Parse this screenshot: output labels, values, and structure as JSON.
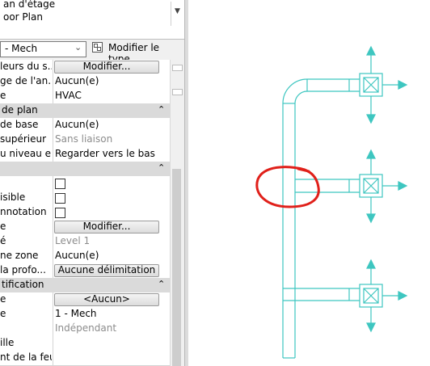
{
  "header": {
    "line1": "an d'étage",
    "line2": "oor Plan"
  },
  "type_selector": {
    "value": "- Mech"
  },
  "edit_type_label": "Modifier le type",
  "rows": [
    {
      "key": "leurs du s...",
      "button": "Modifier..."
    },
    {
      "key": "ge de l'an...",
      "value": "Aucun(e)"
    },
    {
      "key": "e",
      "value": "HVAC"
    },
    {
      "section": " de plan",
      "chevron": "⌃"
    },
    {
      "key": " de base",
      "value": "Aucun(e)"
    },
    {
      "key": "supérieur",
      "value": "Sans liaison",
      "muted": true
    },
    {
      "key": "u niveau e...",
      "value": "Regarder vers le bas"
    },
    {
      "section": "",
      "chevron": "⌃"
    },
    {
      "key": "",
      "checkbox": true
    },
    {
      "key": "isible",
      "checkbox": true
    },
    {
      "key": "nnotation",
      "checkbox": true
    },
    {
      "key": "e",
      "button": "Modifier..."
    },
    {
      "key": "é",
      "value": "Level 1",
      "muted": true
    },
    {
      "key": "ne zone",
      "value": "Aucun(e)"
    },
    {
      "key": " la profo...",
      "button": "Aucune délimitation"
    },
    {
      "section": "tification",
      "chevron": "⌃"
    },
    {
      "key": "e",
      "button": "<Aucun>"
    },
    {
      "key": "e",
      "value": "1 - Mech"
    },
    {
      "key": "",
      "value": "Indépendant",
      "muted": true
    },
    {
      "key": "ille",
      "value": ""
    },
    {
      "key": "nt de la feu...",
      "value": ""
    }
  ],
  "colors": {
    "duct": "#3ec6c0",
    "markup": "#e0201a"
  }
}
